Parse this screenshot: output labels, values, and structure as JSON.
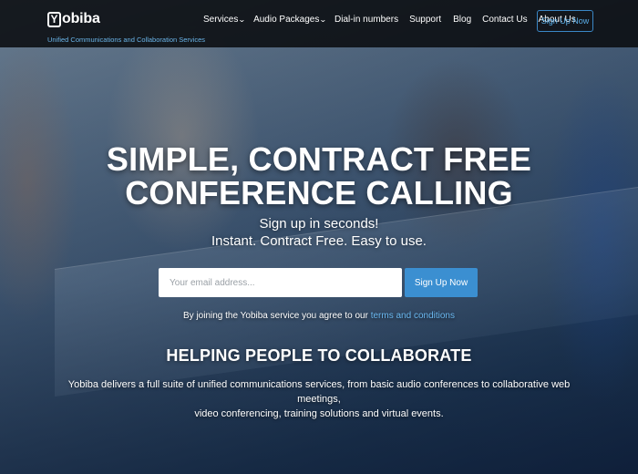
{
  "brand": {
    "logo_mark": "Y",
    "logo_text": "obiba",
    "tagline": "Unified Communications and Collaboration Services"
  },
  "nav": {
    "items": [
      {
        "label": "Services",
        "dropdown": true
      },
      {
        "label": "Audio Packages",
        "dropdown": true
      },
      {
        "label": "Dial-in numbers",
        "dropdown": false
      },
      {
        "label": "Support",
        "dropdown": false
      },
      {
        "label": "Blog",
        "dropdown": false
      },
      {
        "label": "Contact Us",
        "dropdown": false
      },
      {
        "label": "About Us",
        "dropdown": false
      }
    ],
    "signup_label": "Sign Up Now"
  },
  "hero": {
    "headline_line1": "SIMPLE, CONTRACT FREE",
    "headline_line2": "CONFERENCE CALLING",
    "sub_line1": "Sign up in seconds!",
    "sub_line2": "Instant. Contract Free. Easy to use.",
    "email_placeholder": "Your email address...",
    "email_value": "",
    "signup_label": "Sign Up Now",
    "terms_prefix": "By joining the Yobiba service you agree to our",
    "terms_link": "terms and conditions"
  },
  "section": {
    "title": "HELPING PEOPLE TO COLLABORATE",
    "desc_line1": "Yobiba delivers a full suite of unified communications services, from basic audio conferences to collaborative web meetings,",
    "desc_line2": "video conferencing, training solutions and virtual events."
  },
  "colors": {
    "accent": "#3b8fd1",
    "link": "#6ab8f0",
    "nav_bg": "#0a0c10"
  }
}
